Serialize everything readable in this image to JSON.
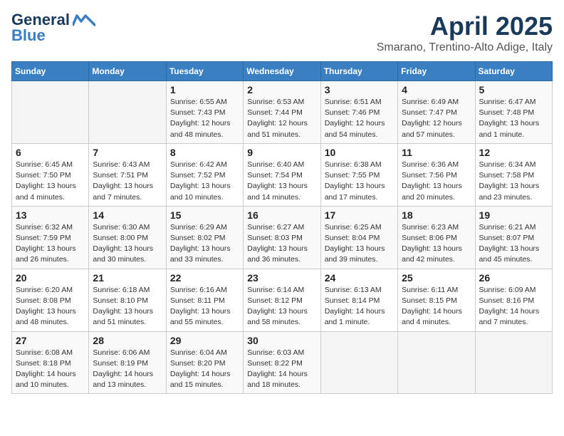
{
  "logo": {
    "line1": "General",
    "line2": "Blue"
  },
  "title": "April 2025",
  "subtitle": "Smarano, Trentino-Alto Adige, Italy",
  "days_header": [
    "Sunday",
    "Monday",
    "Tuesday",
    "Wednesday",
    "Thursday",
    "Friday",
    "Saturday"
  ],
  "weeks": [
    [
      {
        "day": "",
        "info": ""
      },
      {
        "day": "",
        "info": ""
      },
      {
        "day": "1",
        "info": "Sunrise: 6:55 AM\nSunset: 7:43 PM\nDaylight: 12 hours\nand 48 minutes."
      },
      {
        "day": "2",
        "info": "Sunrise: 6:53 AM\nSunset: 7:44 PM\nDaylight: 12 hours\nand 51 minutes."
      },
      {
        "day": "3",
        "info": "Sunrise: 6:51 AM\nSunset: 7:46 PM\nDaylight: 12 hours\nand 54 minutes."
      },
      {
        "day": "4",
        "info": "Sunrise: 6:49 AM\nSunset: 7:47 PM\nDaylight: 12 hours\nand 57 minutes."
      },
      {
        "day": "5",
        "info": "Sunrise: 6:47 AM\nSunset: 7:48 PM\nDaylight: 13 hours\nand 1 minute."
      }
    ],
    [
      {
        "day": "6",
        "info": "Sunrise: 6:45 AM\nSunset: 7:50 PM\nDaylight: 13 hours\nand 4 minutes."
      },
      {
        "day": "7",
        "info": "Sunrise: 6:43 AM\nSunset: 7:51 PM\nDaylight: 13 hours\nand 7 minutes."
      },
      {
        "day": "8",
        "info": "Sunrise: 6:42 AM\nSunset: 7:52 PM\nDaylight: 13 hours\nand 10 minutes."
      },
      {
        "day": "9",
        "info": "Sunrise: 6:40 AM\nSunset: 7:54 PM\nDaylight: 13 hours\nand 14 minutes."
      },
      {
        "day": "10",
        "info": "Sunrise: 6:38 AM\nSunset: 7:55 PM\nDaylight: 13 hours\nand 17 minutes."
      },
      {
        "day": "11",
        "info": "Sunrise: 6:36 AM\nSunset: 7:56 PM\nDaylight: 13 hours\nand 20 minutes."
      },
      {
        "day": "12",
        "info": "Sunrise: 6:34 AM\nSunset: 7:58 PM\nDaylight: 13 hours\nand 23 minutes."
      }
    ],
    [
      {
        "day": "13",
        "info": "Sunrise: 6:32 AM\nSunset: 7:59 PM\nDaylight: 13 hours\nand 26 minutes."
      },
      {
        "day": "14",
        "info": "Sunrise: 6:30 AM\nSunset: 8:00 PM\nDaylight: 13 hours\nand 30 minutes."
      },
      {
        "day": "15",
        "info": "Sunrise: 6:29 AM\nSunset: 8:02 PM\nDaylight: 13 hours\nand 33 minutes."
      },
      {
        "day": "16",
        "info": "Sunrise: 6:27 AM\nSunset: 8:03 PM\nDaylight: 13 hours\nand 36 minutes."
      },
      {
        "day": "17",
        "info": "Sunrise: 6:25 AM\nSunset: 8:04 PM\nDaylight: 13 hours\nand 39 minutes."
      },
      {
        "day": "18",
        "info": "Sunrise: 6:23 AM\nSunset: 8:06 PM\nDaylight: 13 hours\nand 42 minutes."
      },
      {
        "day": "19",
        "info": "Sunrise: 6:21 AM\nSunset: 8:07 PM\nDaylight: 13 hours\nand 45 minutes."
      }
    ],
    [
      {
        "day": "20",
        "info": "Sunrise: 6:20 AM\nSunset: 8:08 PM\nDaylight: 13 hours\nand 48 minutes."
      },
      {
        "day": "21",
        "info": "Sunrise: 6:18 AM\nSunset: 8:10 PM\nDaylight: 13 hours\nand 51 minutes."
      },
      {
        "day": "22",
        "info": "Sunrise: 6:16 AM\nSunset: 8:11 PM\nDaylight: 13 hours\nand 55 minutes."
      },
      {
        "day": "23",
        "info": "Sunrise: 6:14 AM\nSunset: 8:12 PM\nDaylight: 13 hours\nand 58 minutes."
      },
      {
        "day": "24",
        "info": "Sunrise: 6:13 AM\nSunset: 8:14 PM\nDaylight: 14 hours\nand 1 minute."
      },
      {
        "day": "25",
        "info": "Sunrise: 6:11 AM\nSunset: 8:15 PM\nDaylight: 14 hours\nand 4 minutes."
      },
      {
        "day": "26",
        "info": "Sunrise: 6:09 AM\nSunset: 8:16 PM\nDaylight: 14 hours\nand 7 minutes."
      }
    ],
    [
      {
        "day": "27",
        "info": "Sunrise: 6:08 AM\nSunset: 8:18 PM\nDaylight: 14 hours\nand 10 minutes."
      },
      {
        "day": "28",
        "info": "Sunrise: 6:06 AM\nSunset: 8:19 PM\nDaylight: 14 hours\nand 13 minutes."
      },
      {
        "day": "29",
        "info": "Sunrise: 6:04 AM\nSunset: 8:20 PM\nDaylight: 14 hours\nand 15 minutes."
      },
      {
        "day": "30",
        "info": "Sunrise: 6:03 AM\nSunset: 8:22 PM\nDaylight: 14 hours\nand 18 minutes."
      },
      {
        "day": "",
        "info": ""
      },
      {
        "day": "",
        "info": ""
      },
      {
        "day": "",
        "info": ""
      }
    ]
  ]
}
